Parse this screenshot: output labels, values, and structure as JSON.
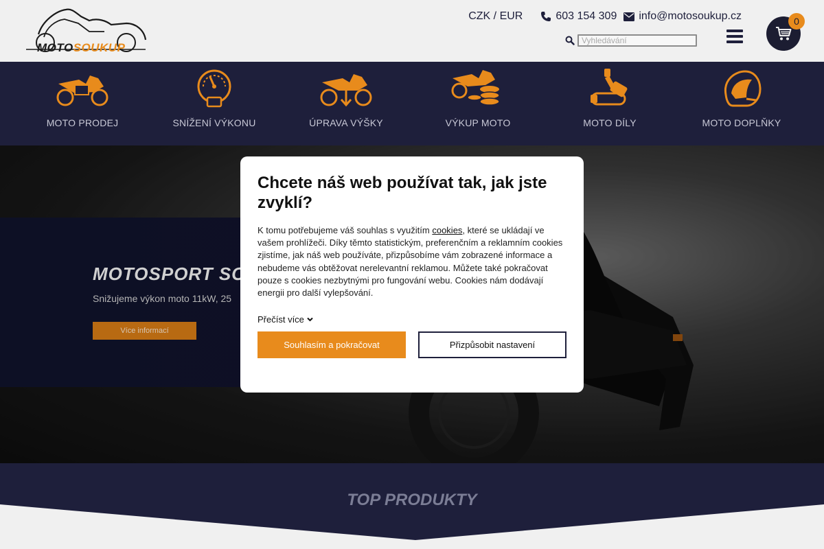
{
  "header": {
    "logo_part1": "MOTO",
    "logo_part2": "SOUKUP",
    "currency_czk": "CZK",
    "currency_sep": "/",
    "currency_eur": "EUR",
    "phone": "603 154 309",
    "email": "info@motosoukup.cz",
    "search_placeholder": "Vyhledávání",
    "cart_count": "0"
  },
  "nav": {
    "items": [
      {
        "label": "MOTO PRODEJ",
        "icon": "motorcycle-icon"
      },
      {
        "label": "SNÍŽENÍ VÝKONU",
        "icon": "speedometer-icon"
      },
      {
        "label": "ÚPRAVA VÝŠKY",
        "icon": "lowering-icon"
      },
      {
        "label": "VÝKUP MOTO",
        "icon": "motorcycle-coins-icon"
      },
      {
        "label": "MOTO DÍLY",
        "icon": "exhaust-icon"
      },
      {
        "label": "MOTO DOPLŇKY",
        "icon": "helmet-icon"
      }
    ]
  },
  "hero": {
    "title": "MOTOSPORT SOU",
    "subtitle": "Snižujeme výkon moto 11kW, 25",
    "button": "Více informací"
  },
  "top_products": {
    "title": "TOP PRODUKTY"
  },
  "cookie_modal": {
    "title": "Chcete náš web používat tak, jak jste zvyklí?",
    "text_before_link": "K tomu potřebujeme váš souhlas s využitím ",
    "link": "cookies",
    "text_after_link": ", které se ukládají ve vašem prohlížeči. Díky těmto statistickým, preferenčním a reklamním cookies zjistíme, jak náš web používáte, přizpůsobíme vám zobrazené informace a nebudeme vás obtěžovat nerelevantní reklamou. Můžete také pokračovat pouze s cookies nezbytnými pro fungování webu. Cookies nám dodávají energii pro další vylepšování.",
    "read_more": "Přečíst více",
    "accept_button": "Souhlasím a pokračovat",
    "customize_button": "Přizpůsobit nastavení"
  },
  "colors": {
    "navy": "#1e1f3b",
    "accent": "#e88b1c",
    "header_bg": "#f0f0f0"
  }
}
